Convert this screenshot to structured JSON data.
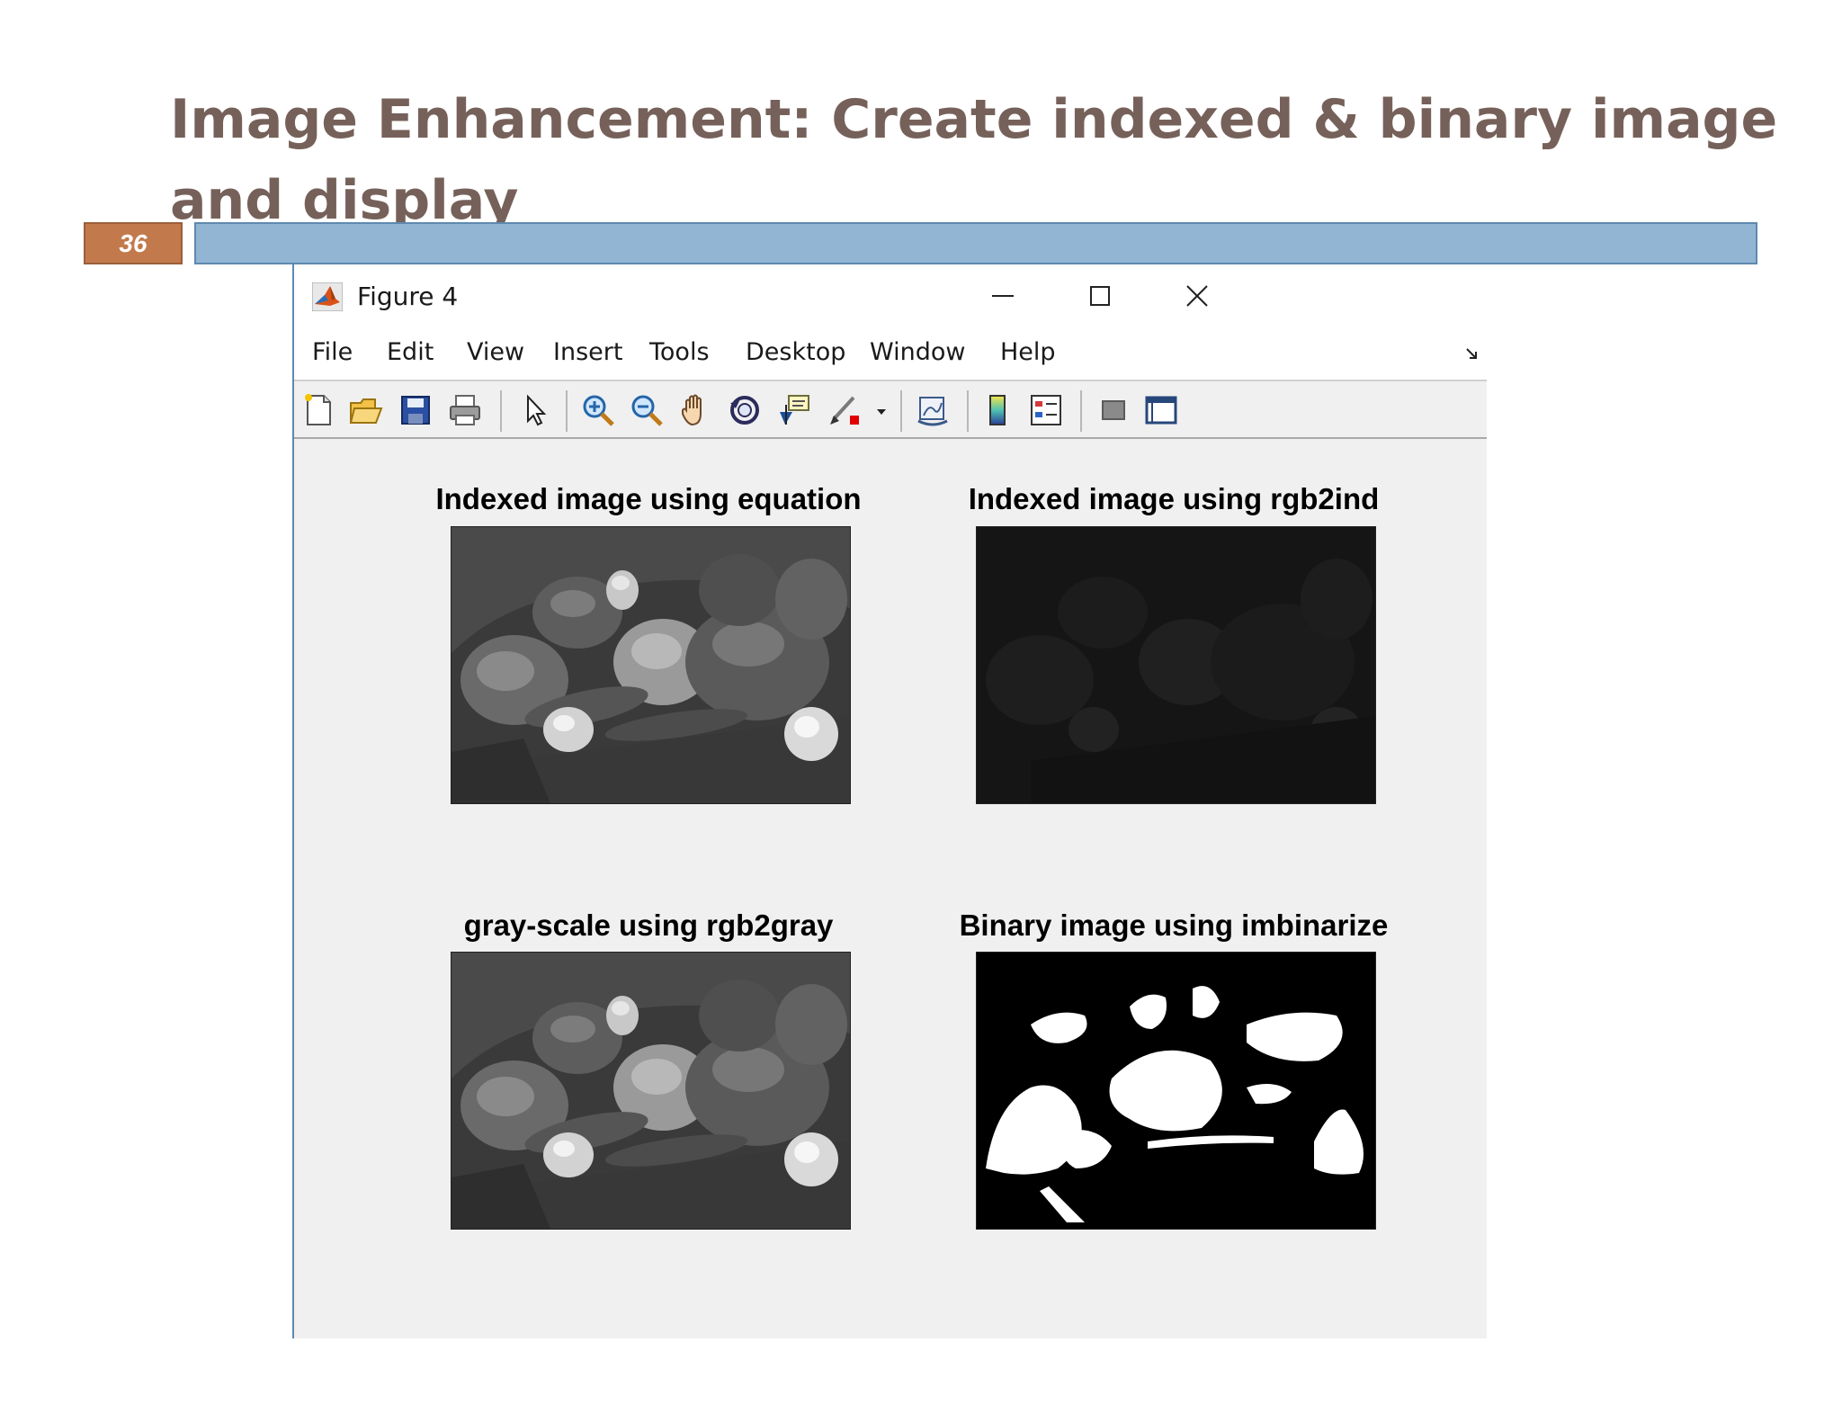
{
  "slide": {
    "title": "Image Enhancement: Create indexed & binary image and display",
    "number": "36"
  },
  "window": {
    "title": "Figure 4",
    "menu": [
      "File",
      "Edit",
      "View",
      "Insert",
      "Tools",
      "Desktop",
      "Window",
      "Help"
    ]
  },
  "toolbar": {
    "icons": [
      "new-figure-icon",
      "open-file-icon",
      "save-icon",
      "print-icon",
      "select-arrow-icon",
      "zoom-in-icon",
      "zoom-out-icon",
      "pan-hand-icon",
      "rotate-3d-icon",
      "data-cursor-icon",
      "brush-icon",
      "link-plot-icon",
      "colorbar-icon",
      "legend-icon",
      "hide-plot-tools-icon",
      "show-plot-tools-icon"
    ]
  },
  "axes": [
    {
      "title": "Indexed image using equation",
      "style": "grayscale"
    },
    {
      "title": "Indexed image using rgb2ind",
      "style": "dark"
    },
    {
      "title": "gray-scale using rgb2gray",
      "style": "grayscale"
    },
    {
      "title": "Binary image using imbinarize",
      "style": "binary"
    }
  ]
}
